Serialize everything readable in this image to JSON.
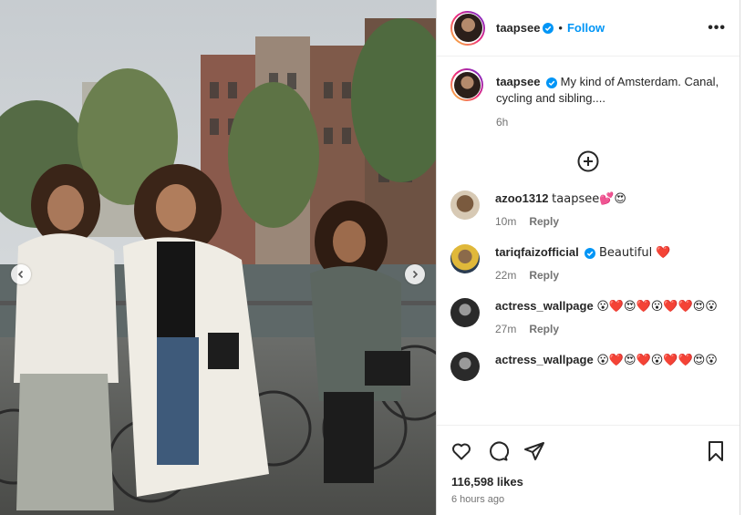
{
  "post": {
    "author": "taapsee",
    "follow_label": "Follow",
    "separator": "•",
    "more_label": "•••"
  },
  "caption": {
    "author": "taapsee",
    "text": "My kind of Amsterdam. Canal, cycling and sibling....",
    "time": "6h"
  },
  "comments": [
    {
      "user": "azoo1312",
      "text": "taapsee💕😍",
      "time": "10m",
      "reply": "Reply",
      "verified": false
    },
    {
      "user": "tariqfaizofficial",
      "text": "Beautiful ❤️",
      "time": "22m",
      "reply": "Reply",
      "verified": true
    },
    {
      "user": "actress_wallpage",
      "text": "😮❤️😍❤️😮❤️❤️😍😮",
      "time": "27m",
      "reply": "Reply",
      "verified": false
    },
    {
      "user": "actress_wallpage",
      "text": "😮❤️😍❤️😮❤️❤️😍😮",
      "time": "",
      "reply": "",
      "verified": false
    }
  ],
  "likes": "116,598 likes",
  "posted_ago": "6 hours ago",
  "colors": {
    "accent": "#0095f6",
    "verified": "#0095f6"
  },
  "icons": [
    "heart-icon",
    "comment-icon",
    "share-icon",
    "bookmark-icon",
    "add-circle-icon",
    "chevron-left-icon",
    "chevron-right-icon",
    "verified-badge-icon",
    "more-options-icon"
  ]
}
